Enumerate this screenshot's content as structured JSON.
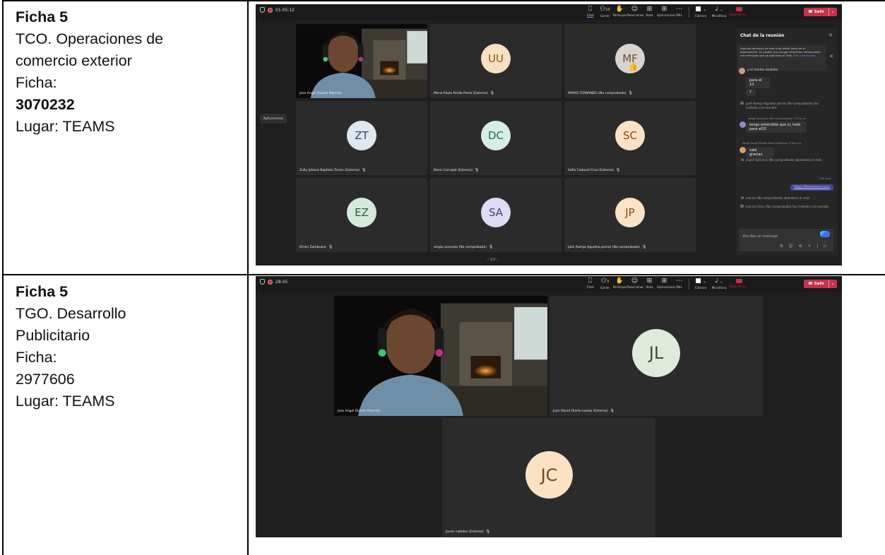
{
  "rows": [
    {
      "lines": [
        {
          "text": "Ficha 5",
          "bold": true
        },
        {
          "text": "TCO. Operaciones de",
          "bold": false
        },
        {
          "text": "comercio exterior",
          "bold": false
        },
        {
          "text": "Ficha:",
          "bold": false
        },
        {
          "text": "3070232",
          "bold": true
        },
        {
          "text": "Lugar: TEAMS",
          "bold": false
        }
      ]
    },
    {
      "lines": [
        {
          "text": "Ficha 5",
          "bold": true
        },
        {
          "text": "TGO. Desarrollo",
          "bold": false
        },
        {
          "text": "Publicitario",
          "bold": false
        },
        {
          "text": "Ficha:",
          "bold": false
        },
        {
          "text": "2977606",
          "bold": false
        },
        {
          "text": "Lugar: TEAMS",
          "bold": false
        }
      ]
    }
  ],
  "meeting1": {
    "timer": "01:05:12",
    "toolbar": [
      {
        "name": "chat",
        "label": "Chat",
        "icon": "chat-icon",
        "glyph": "⎕",
        "active": true
      },
      {
        "name": "people",
        "label": "Gente",
        "icon": "people-icon",
        "glyph": "⚇",
        "count": "10"
      },
      {
        "name": "raise-hand",
        "label": "Participar",
        "icon": "hand-icon",
        "glyph": "✋"
      },
      {
        "name": "react",
        "label": "Reacciones",
        "icon": "smile-icon",
        "glyph": "☺"
      },
      {
        "name": "view",
        "label": "Vista",
        "icon": "grid-icon",
        "glyph": "⊞"
      },
      {
        "name": "apps",
        "label": "Aplicaciones",
        "icon": "plus-box-icon",
        "glyph": "⊞"
      },
      {
        "name": "more",
        "label": "Más",
        "icon": "ellipsis-icon",
        "glyph": "⋯"
      }
    ],
    "devices": [
      {
        "name": "camera",
        "label": "Cámara",
        "icon": "camera-icon",
        "glyph": "■"
      },
      {
        "name": "mic",
        "label": "Micrófono",
        "icon": "mic-icon",
        "glyph": "♩"
      }
    ],
    "share_label": "Dejar de co...",
    "leave_label": "Salir",
    "apps_button": "Aplicaciones",
    "pager": "1/2",
    "tiles": [
      {
        "initials": "",
        "name": "Jose Angel Duarte Palechor",
        "video": true
      },
      {
        "initials": "UU",
        "name": "Maria Paula Pinilla Perez (Externo)",
        "bg": "#f6e0c1",
        "fg": "#8a5a1a"
      },
      {
        "initials": "MF",
        "name": "MARIO FERNANDO (No comprobado)",
        "bg": "#d9d3cf",
        "fg": "#6b4a3a",
        "reaction": "👍"
      },
      {
        "initials": "ZT",
        "name": "Zully Johana Baptista Torres (Externo)",
        "bg": "#dfe7ef",
        "fg": "#2f4b63"
      },
      {
        "initials": "DC",
        "name": "Denis Carvajal (Externo)",
        "bg": "#d6efe6",
        "fg": "#1f6b53"
      },
      {
        "initials": "SC",
        "name": "Sofia Cadavid Cruz (Externo)",
        "bg": "#fbe1c6",
        "fg": "#8c4a12"
      },
      {
        "initials": "EZ",
        "name": "Efrain Zambrano",
        "bg": "#d3eadc",
        "fg": "#2d5b3e"
      },
      {
        "initials": "SA",
        "name": "sergio acevedo (No comprobado)",
        "bg": "#dcdcf4",
        "fg": "#3c3c8a"
      },
      {
        "initials": "JP",
        "name": "José Avenjo Agudelo porras (No comprobado)",
        "bg": "#fbe2c4",
        "fg": "#8a4c10"
      }
    ],
    "chat": {
      "title": "Chat de la reunión",
      "notice": "Algunas personas de este chat están fuera de tu organización. Es posible que tengan directivas relacionadas con mensajes que se aplicarán al chat.",
      "notice_link": "Más información",
      "msg_top": "y el martes también",
      "bubble1": "para el 10",
      "bubble2": "?",
      "sys1": "José Avenjo Agudelo porras (No comprobado) fue invitado a la reunión.",
      "meta1": "sergio acevedo (No comprobado)  7:25 p.m.",
      "bubble3": "tengo entendido que si, todo para el10",
      "meta2": "Maria Paula Pinilla Perez (Externo)  7:28 p.m.",
      "bubble4": "vale gracias",
      "sys2": "ingrid Sánchez (No comprobado) abandonó el chat.",
      "time_right": "7:41 p.m.",
      "link": "https://fouliemno.com/",
      "sys3": "Ivonne (No comprobado) abandonó el chat.",
      "sys4": "Ivonne Giron (No comprobado) fue invitado a la reunión.",
      "placeholder": "Escribe un mensaje",
      "compose_icons": "A ☺ ⊚ + | ▷"
    }
  },
  "meeting2": {
    "timer": "28:45",
    "toolbar": [
      {
        "name": "chat",
        "label": "Chat",
        "icon": "chat-icon",
        "glyph": "⎕"
      },
      {
        "name": "people",
        "label": "Gente",
        "icon": "people-icon",
        "glyph": "⚇",
        "count": "3"
      },
      {
        "name": "raise-hand",
        "label": "Participar",
        "icon": "hand-icon",
        "glyph": "✋"
      },
      {
        "name": "react",
        "label": "Reaccionar",
        "icon": "smile-icon",
        "glyph": "☺"
      },
      {
        "name": "view",
        "label": "Vista",
        "icon": "grid-icon",
        "glyph": "⊞"
      },
      {
        "name": "apps",
        "label": "Aplicaciones",
        "icon": "plus-box-icon",
        "glyph": "⊞"
      },
      {
        "name": "more",
        "label": "Más",
        "icon": "ellipsis-icon",
        "glyph": "⋯"
      }
    ],
    "devices": [
      {
        "name": "camera",
        "label": "Cámara",
        "icon": "camera-icon",
        "glyph": "■"
      },
      {
        "name": "mic",
        "label": "Micrófono",
        "icon": "mic-icon",
        "glyph": "♩"
      }
    ],
    "share_label": "Dejar de co...",
    "leave_label": "Salir",
    "tiles": [
      {
        "initials": "",
        "name": "Jose Angel Duarte Palechor",
        "video": true
      },
      {
        "initials": "JL",
        "name": "Juan David Olarte Loaiza (Externo)",
        "bg": "#dfe9dc",
        "fg": "#3b4a37"
      },
      {
        "initials": "JC",
        "name": "javier cubides (Externo)",
        "bg": "#fbe2c4",
        "fg": "#7a4a16"
      }
    ]
  },
  "colors": {
    "teams_accent": "#7f85f5",
    "leave_red": "#c4314b"
  }
}
